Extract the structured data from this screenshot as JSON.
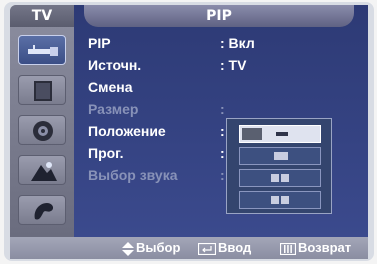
{
  "header": {
    "source_tab": "TV",
    "menu_title": "PIP"
  },
  "sidebar": {
    "items": [
      {
        "icon": "antenna-input-icon",
        "active": true
      },
      {
        "icon": "picture-icon",
        "active": false
      },
      {
        "icon": "sound-icon",
        "active": false
      },
      {
        "icon": "channel-icon",
        "active": false
      },
      {
        "icon": "setup-icon",
        "active": false
      }
    ]
  },
  "menu": {
    "items": [
      {
        "label": "PIP",
        "value": ": Вкл",
        "enabled": true
      },
      {
        "label": "Источн.",
        "value": ": TV",
        "enabled": true
      },
      {
        "label": "Смена",
        "value": "",
        "enabled": true
      },
      {
        "label": "Размер",
        "value": ":",
        "enabled": false
      },
      {
        "label": "Положение",
        "value": ":",
        "enabled": true
      },
      {
        "label": "Прог.",
        "value": ":",
        "enabled": true
      },
      {
        "label": "Выбор звука",
        "value": ":",
        "enabled": false
      }
    ]
  },
  "size_popup": {
    "options": [
      {
        "icon": "pip-large-icon",
        "selected": true
      },
      {
        "icon": "pip-small-icon",
        "selected": false
      },
      {
        "icon": "pip-double-small-icon",
        "selected": false
      },
      {
        "icon": "pip-double-large-icon",
        "selected": false
      }
    ]
  },
  "footer": {
    "select_label": "Выбор",
    "enter_label": "Ввод",
    "return_label": "Возврат"
  },
  "colors": {
    "panel": "#2d3a75",
    "sidebar": "#7a7c8e",
    "accent": "#5a6fa6",
    "dimmed_text": "#8892b8"
  }
}
